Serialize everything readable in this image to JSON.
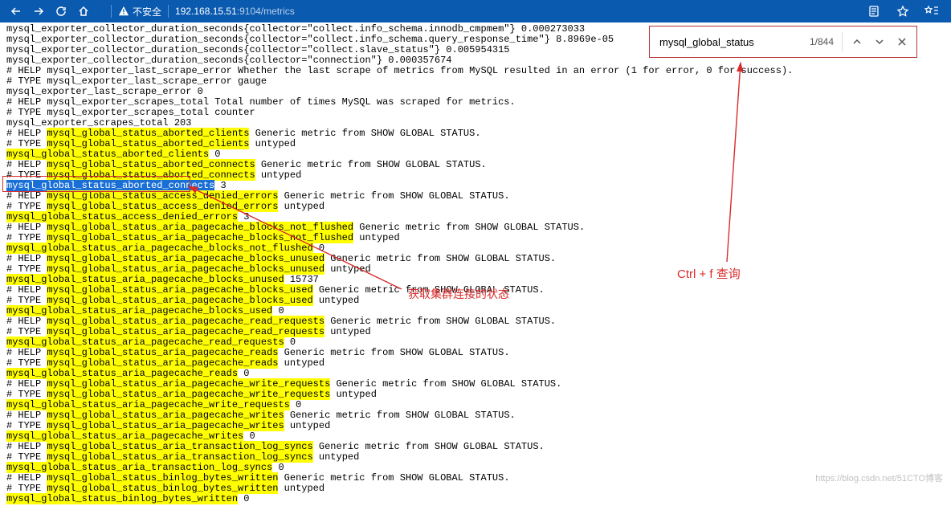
{
  "browser": {
    "insecure_label": "不安全",
    "host": "192.168.15.51",
    "port_path": ":9104/metrics"
  },
  "find": {
    "query": "mysql_global_status",
    "count": "1/844"
  },
  "annot": {
    "label1": "获取集群连接的状态",
    "label2": "Ctrl + f 查询"
  },
  "watermark": "https://blog.csdn.net/51CTO博客",
  "search_term": "mysql_global_status",
  "lines": [
    {
      "t": "mysql_exporter_collector_duration_seconds{collector=\"collect.info_schema.innodb_cmpmem\"} 0.000273033"
    },
    {
      "t": "mysql_exporter_collector_duration_seconds{collector=\"collect.info_schema.query_response_time\"} 8.8969e-05"
    },
    {
      "t": "mysql_exporter_collector_duration_seconds{collector=\"collect.slave_status\"} 0.005954315"
    },
    {
      "t": "mysql_exporter_collector_duration_seconds{collector=\"connection\"} 0.000357674"
    },
    {
      "t": "# HELP mysql_exporter_last_scrape_error Whether the last scrape of metrics from MySQL resulted in an error (1 for error, 0 for success)."
    },
    {
      "t": "# TYPE mysql_exporter_last_scrape_error gauge"
    },
    {
      "t": "mysql_exporter_last_scrape_error 0"
    },
    {
      "t": "# HELP mysql_exporter_scrapes_total Total number of times MySQL was scraped for metrics."
    },
    {
      "t": "# TYPE mysql_exporter_scrapes_total counter"
    },
    {
      "t": "mysql_exporter_scrapes_total 203"
    },
    {
      "t": "# HELP mysql_global_status_aborted_clients Generic metric from SHOW GLOBAL STATUS."
    },
    {
      "t": "# TYPE mysql_global_status_aborted_clients untyped"
    },
    {
      "t": "mysql_global_status_aborted_clients 0"
    },
    {
      "t": "# HELP mysql_global_status_aborted_connects Generic metric from SHOW GLOBAL STATUS."
    },
    {
      "t": "# TYPE mysql_global_status_aborted_connects untyped"
    },
    {
      "t": "mysql_global_status_aborted_connects 3",
      "sel": true
    },
    {
      "t": "# HELP mysql_global_status_access_denied_errors Generic metric from SHOW GLOBAL STATUS."
    },
    {
      "t": "# TYPE mysql_global_status_access_denied_errors untyped"
    },
    {
      "t": "mysql_global_status_access_denied_errors 3"
    },
    {
      "t": "# HELP mysql_global_status_aria_pagecache_blocks_not_flushed Generic metric from SHOW GLOBAL STATUS."
    },
    {
      "t": "# TYPE mysql_global_status_aria_pagecache_blocks_not_flushed untyped"
    },
    {
      "t": "mysql_global_status_aria_pagecache_blocks_not_flushed 0"
    },
    {
      "t": "# HELP mysql_global_status_aria_pagecache_blocks_unused Generic metric from SHOW GLOBAL STATUS."
    },
    {
      "t": "# TYPE mysql_global_status_aria_pagecache_blocks_unused untyped"
    },
    {
      "t": "mysql_global_status_aria_pagecache_blocks_unused 15737"
    },
    {
      "t": "# HELP mysql_global_status_aria_pagecache_blocks_used Generic metric from SHOW GLOBAL STATUS."
    },
    {
      "t": "# TYPE mysql_global_status_aria_pagecache_blocks_used untyped"
    },
    {
      "t": "mysql_global_status_aria_pagecache_blocks_used 0"
    },
    {
      "t": "# HELP mysql_global_status_aria_pagecache_read_requests Generic metric from SHOW GLOBAL STATUS."
    },
    {
      "t": "# TYPE mysql_global_status_aria_pagecache_read_requests untyped"
    },
    {
      "t": "mysql_global_status_aria_pagecache_read_requests 0"
    },
    {
      "t": "# HELP mysql_global_status_aria_pagecache_reads Generic metric from SHOW GLOBAL STATUS."
    },
    {
      "t": "# TYPE mysql_global_status_aria_pagecache_reads untyped"
    },
    {
      "t": "mysql_global_status_aria_pagecache_reads 0"
    },
    {
      "t": "# HELP mysql_global_status_aria_pagecache_write_requests Generic metric from SHOW GLOBAL STATUS."
    },
    {
      "t": "# TYPE mysql_global_status_aria_pagecache_write_requests untyped"
    },
    {
      "t": "mysql_global_status_aria_pagecache_write_requests 0"
    },
    {
      "t": "# HELP mysql_global_status_aria_pagecache_writes Generic metric from SHOW GLOBAL STATUS."
    },
    {
      "t": "# TYPE mysql_global_status_aria_pagecache_writes untyped"
    },
    {
      "t": "mysql_global_status_aria_pagecache_writes 0"
    },
    {
      "t": "# HELP mysql_global_status_aria_transaction_log_syncs Generic metric from SHOW GLOBAL STATUS."
    },
    {
      "t": "# TYPE mysql_global_status_aria_transaction_log_syncs untyped"
    },
    {
      "t": "mysql_global_status_aria_transaction_log_syncs 0"
    },
    {
      "t": "# HELP mysql_global_status_binlog_bytes_written Generic metric from SHOW GLOBAL STATUS."
    },
    {
      "t": "# TYPE mysql_global_status_binlog_bytes_written untyped"
    },
    {
      "t": "mysql_global_status_binlog_bytes_written 0"
    }
  ]
}
